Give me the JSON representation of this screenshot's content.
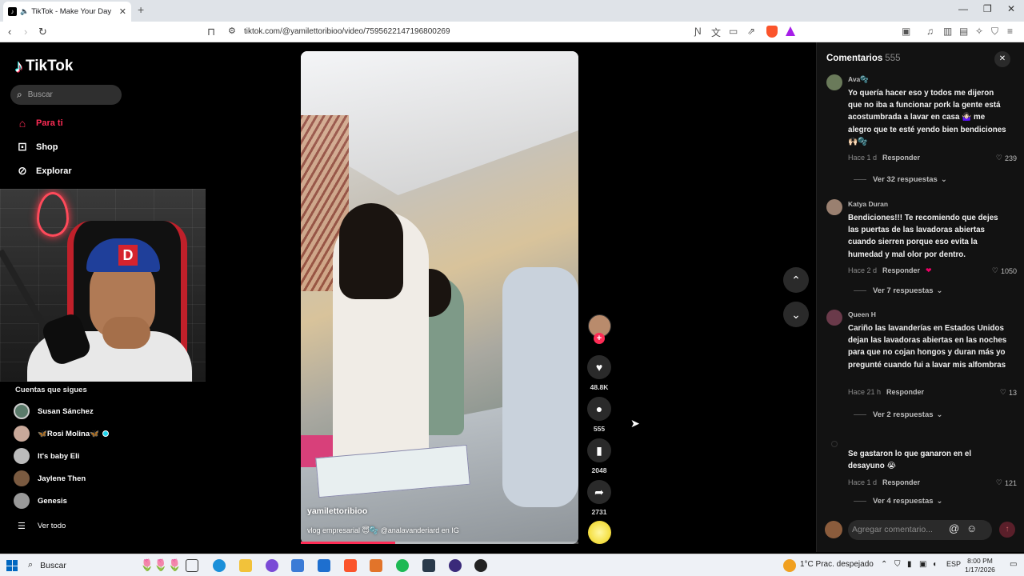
{
  "browser": {
    "tab_title": "TikTok - Make Your Day",
    "url": "tiktok.com/@yamilettoribioo/video/7595622147196800269"
  },
  "sidebar": {
    "logo": "TikTok",
    "search_placeholder": "Buscar",
    "nav": [
      {
        "label": "Para ti"
      },
      {
        "label": "Shop"
      },
      {
        "label": "Explorar"
      }
    ],
    "following_header": "Cuentas que sigues",
    "following": [
      {
        "name": "Susan Sánchez"
      },
      {
        "name": "🦋Rosi Molina🦋"
      },
      {
        "name": "It's baby Eli"
      },
      {
        "name": "Jaylene Then"
      },
      {
        "name": "Genesis"
      }
    ],
    "see_all": "Ver todo"
  },
  "video": {
    "author": "yamilettoribioo",
    "caption": "vlog empresarial 😇🫧 @analavanderiard   en IG",
    "progress": 0.34
  },
  "actions": {
    "likes": "48.8K",
    "comments": "555",
    "saves": "2048",
    "shares": "2731"
  },
  "comments_panel": {
    "title": "Comentarios",
    "count": "555",
    "input_placeholder": "Agregar comentario...",
    "items": [
      {
        "user": "Ava🫧",
        "text": "Yo quería hacer eso y todos me dijeron que no iba a funcionar pork la gente está acostumbrada a lavar en casa 🤷🏻‍♀️ me alegro que te esté yendo bien bendiciones 🙌🏻🫧",
        "time": "Hace 1 d",
        "reply": "Responder",
        "likes": "239",
        "replies": "Ver 32 respuestas"
      },
      {
        "user": "Katya Duran",
        "text": "Bendiciones!!! Te recomiendo que dejes las puertas de las lavadoras abiertas cuando sierren porque eso evita la humedad y mal olor por dentro.",
        "time": "Hace 2 d",
        "reply": "Responder",
        "likes": "1050",
        "replies": "Ver 7 respuestas"
      },
      {
        "user": "Queen H",
        "text": "Cariño las lavanderías en Estados Unidos dejan las lavadoras abiertas en las noches para que no cojan hongos y duran más yo pregunté cuando fui a lavar mis alfombras",
        "time": "Hace 21 h",
        "reply": "Responder",
        "likes": "13",
        "replies": "Ver 2 respuestas"
      },
      {
        "user": "",
        "text": "Se gastaron lo que ganaron en el desayuno 😭",
        "time": "Hace 1 d",
        "reply": "Responder",
        "likes": "121",
        "replies": "Ver 4 respuestas"
      }
    ]
  },
  "taskbar": {
    "search": "Buscar",
    "weather": "1°C  Prac. despejado",
    "lang": "ESP",
    "time": "8:00 PM",
    "date": "1/17/2026"
  },
  "colors": {
    "tiktok_red": "#fe2c55",
    "panel_bg": "#121212"
  }
}
